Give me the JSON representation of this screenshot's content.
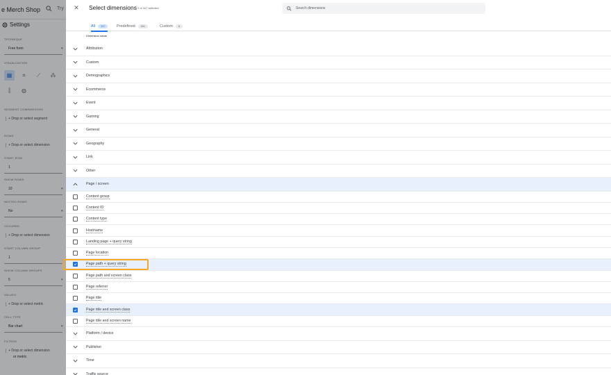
{
  "background": {
    "title": "e Merch Shop",
    "search_text": "Try",
    "settings_label": "Settings",
    "technique_label": "TECHNIQUE",
    "technique_value": "Free form",
    "visualization_label": "VISUALIZATION",
    "segment_label": "SEGMENT COMPARISONS",
    "segment_drop": "Drop or select segment",
    "rows_label": "ROWS",
    "rows_drop": "Drop or select dimension",
    "start_row_label": "START ROW",
    "start_row_value": "1",
    "show_rows_label": "SHOW ROWS",
    "show_rows_value": "10",
    "nested_rows_label": "NESTED ROWS",
    "nested_rows_value": "No",
    "columns_label": "COLUMNS",
    "columns_drop": "Drop or select dimension",
    "start_col_label": "START COLUMN GROUP",
    "start_col_value": "1",
    "show_col_label": "SHOW COLUMN GROUPS",
    "show_col_value": "5",
    "values_label": "VALUES",
    "values_drop": "Drop or select metric",
    "cell_type_label": "CELL TYPE",
    "cell_type_value": "Bar chart",
    "filters_label": "FILTERS",
    "filters_drop_1": "Drop or select dimension",
    "filters_drop_2": "or metric"
  },
  "drawer": {
    "close_icon": "close-icon",
    "title": "Select dimensions",
    "selected_count": "2 of 347 selected",
    "search_placeholder": "Search dimensions",
    "tabs": [
      {
        "label": "All",
        "count": "347",
        "active": true
      },
      {
        "label": "Predefined",
        "count": "341",
        "active": false
      },
      {
        "label": "Custom",
        "count": "6",
        "active": false
      }
    ],
    "column_header": "Dimension name",
    "rows": [
      {
        "type": "category",
        "label": "Attribution",
        "expanded": false
      },
      {
        "type": "category",
        "label": "Custom",
        "expanded": false
      },
      {
        "type": "category",
        "label": "Demographics",
        "expanded": false
      },
      {
        "type": "category",
        "label": "Ecommerce",
        "expanded": false
      },
      {
        "type": "category",
        "label": "Event",
        "expanded": false
      },
      {
        "type": "category",
        "label": "Gaming",
        "expanded": false
      },
      {
        "type": "category",
        "label": "General",
        "expanded": false
      },
      {
        "type": "category",
        "label": "Geography",
        "expanded": false
      },
      {
        "type": "category",
        "label": "Link",
        "expanded": false
      },
      {
        "type": "category",
        "label": "Other",
        "expanded": false
      },
      {
        "type": "category",
        "label": "Page / screen",
        "expanded": true
      },
      {
        "type": "item",
        "label": "Content group",
        "checked": false
      },
      {
        "type": "item",
        "label": "Content ID",
        "checked": false
      },
      {
        "type": "item",
        "label": "Content type",
        "checked": false
      },
      {
        "type": "item",
        "label": "Hostname",
        "checked": false
      },
      {
        "type": "item",
        "label": "Landing page + query string",
        "checked": false
      },
      {
        "type": "item",
        "label": "Page location",
        "checked": false
      },
      {
        "type": "item",
        "label": "Page path + query string",
        "checked": true
      },
      {
        "type": "item",
        "label": "Page path and screen class",
        "checked": false
      },
      {
        "type": "item",
        "label": "Page referrer",
        "checked": false
      },
      {
        "type": "item",
        "label": "Page title",
        "checked": false
      },
      {
        "type": "item",
        "label": "Page title and screen class",
        "checked": true
      },
      {
        "type": "item",
        "label": "Page title and screen name",
        "checked": false
      },
      {
        "type": "category",
        "label": "Platform / device",
        "expanded": false
      },
      {
        "type": "category",
        "label": "Publisher",
        "expanded": false
      },
      {
        "type": "category",
        "label": "Time",
        "expanded": false
      },
      {
        "type": "category",
        "label": "Traffic source",
        "expanded": false
      }
    ]
  },
  "colors": {
    "accent": "#1a73e8",
    "highlight_row": "#e8f0fe",
    "focus_outline": "#f5a623"
  }
}
